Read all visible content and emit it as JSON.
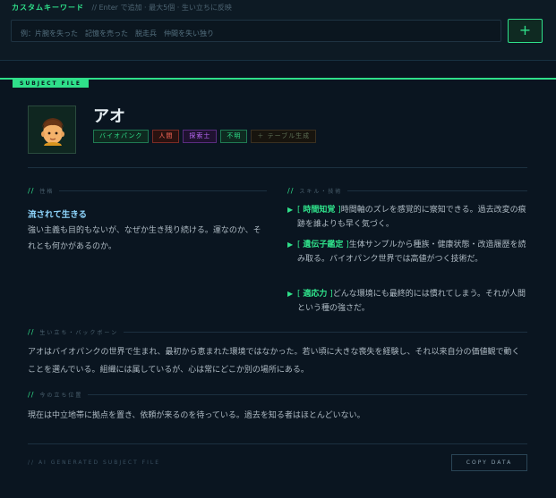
{
  "keyword": {
    "title": "カスタムキーワード",
    "hint": "// Enter で追加 · 最大5個 · 生い立ちに反映",
    "placeholder": "例：片腕を失った　記憶を売った　脱走兵　仲間を失い独り",
    "add_label": "+"
  },
  "subject": {
    "tag": "SUBJECT FILE",
    "name": "アオ",
    "avatar_icon": "avatar-face-icon",
    "tags": [
      "バイオパンク",
      "人間",
      "探索士",
      "不明",
      "＋ テーブル生成"
    ]
  },
  "personality": {
    "section_label": "性格",
    "title": "流されて生きる",
    "body": "強い主義も目的もないが、なぜか生き残り続ける。運なのか、それとも何かがあるのか。"
  },
  "skills": {
    "section_label": "スキル・技術",
    "items": [
      {
        "name": "時間知覚",
        "desc": "時間軸のズレを感覚的に察知できる。過去改変の痕跡を誰よりも早く気づく。"
      },
      {
        "name": "遺伝子鑑定",
        "desc": "生体サンプルから種族・健康状態・改造履歴を読み取る。バイオパンク世界では高値がつく技術だ。"
      },
      {
        "name": "適応力",
        "desc": "どんな環境にも最終的には慣れてしまう。それが人間という種の強さだ。"
      }
    ]
  },
  "backstory": {
    "section_label": "生い立ち・バックボーン",
    "body": "アオはバイオパンクの世界で生まれ、最初から恵まれた環境ではなかった。若い頃に大きな喪失を経験し、それ以来自分の価値観で動くことを選んでいる。組織には属しているが、心は常にどこか別の場所にある。"
  },
  "current": {
    "section_label": "今の立ち位置",
    "body": "現在は中立地帯に拠点を置き、依頼が来るのを待っている。過去を知る者はほとんどいない。"
  },
  "footer": {
    "note": "// AI GENERATED SUBJECT FILE",
    "copy_label": "COPY DATA"
  },
  "colors": {
    "accent": "#2fe08a",
    "background": "#0a1520"
  }
}
